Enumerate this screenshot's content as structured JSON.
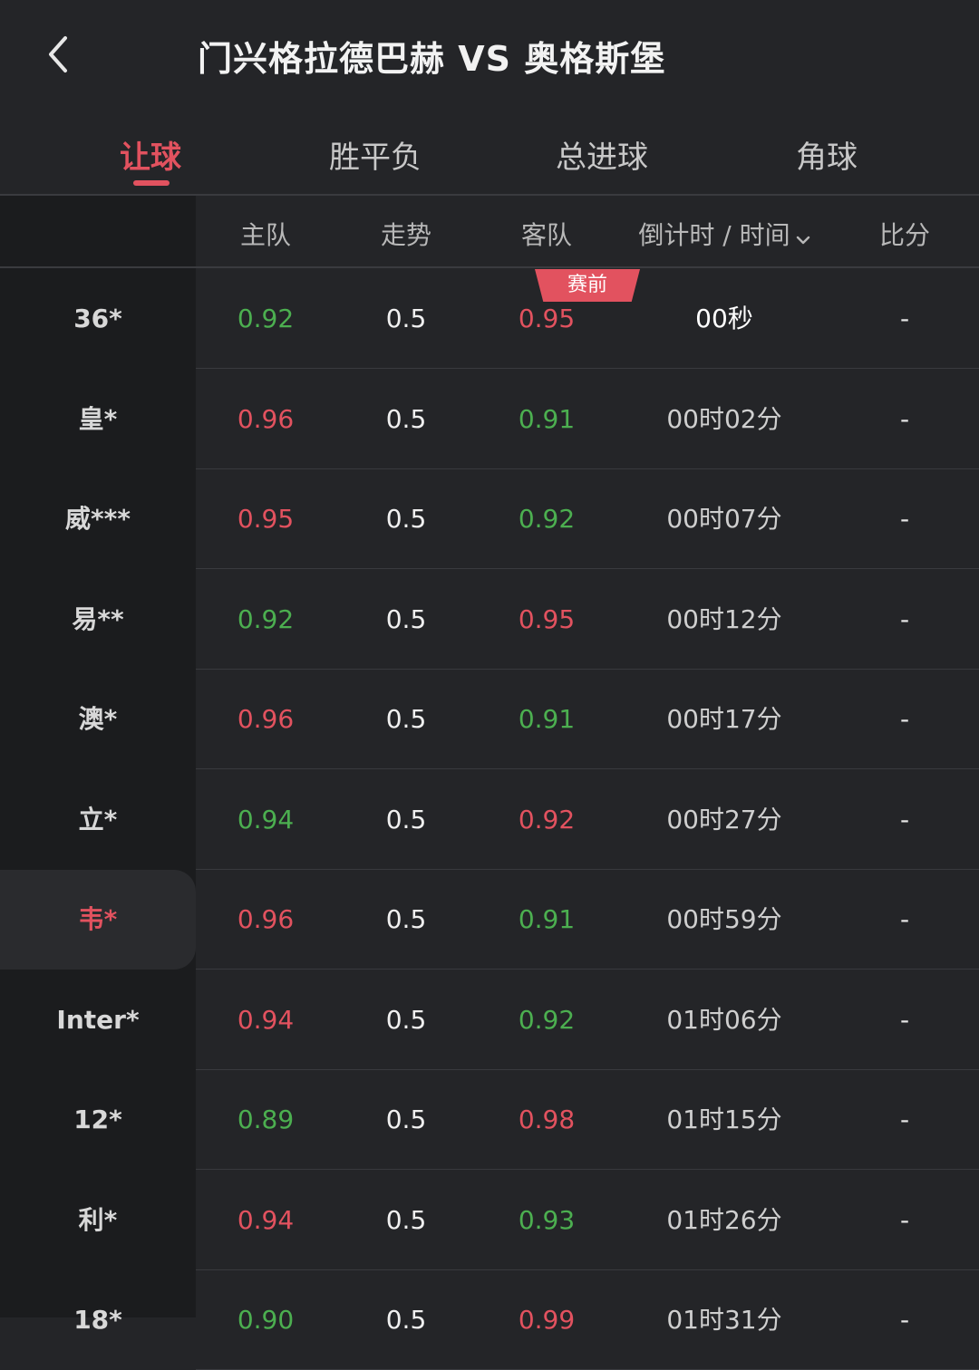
{
  "header": {
    "title": "门兴格拉德巴赫 VS 奥格斯堡"
  },
  "tabs": [
    {
      "label": "让球",
      "active": true
    },
    {
      "label": "胜平负",
      "active": false
    },
    {
      "label": "总进球",
      "active": false
    },
    {
      "label": "角球",
      "active": false
    }
  ],
  "columns": {
    "home": "主队",
    "trend": "走势",
    "away": "客队",
    "time": "倒计时 / 时间",
    "score": "比分"
  },
  "badge": "赛前",
  "rows": [
    {
      "name": "36*",
      "home": "0.92",
      "home_color": "green",
      "trend": "0.5",
      "away": "0.95",
      "away_color": "red",
      "time": "00秒",
      "score": "-"
    },
    {
      "name": "皇*",
      "home": "0.96",
      "home_color": "red",
      "trend": "0.5",
      "away": "0.91",
      "away_color": "green",
      "time": "00时02分",
      "score": "-"
    },
    {
      "name": "威***",
      "home": "0.95",
      "home_color": "red",
      "trend": "0.5",
      "away": "0.92",
      "away_color": "green",
      "time": "00时07分",
      "score": "-"
    },
    {
      "name": "易**",
      "home": "0.92",
      "home_color": "green",
      "trend": "0.5",
      "away": "0.95",
      "away_color": "red",
      "time": "00时12分",
      "score": "-"
    },
    {
      "name": "澳*",
      "home": "0.96",
      "home_color": "red",
      "trend": "0.5",
      "away": "0.91",
      "away_color": "green",
      "time": "00时17分",
      "score": "-"
    },
    {
      "name": "立*",
      "home": "0.94",
      "home_color": "green",
      "trend": "0.5",
      "away": "0.92",
      "away_color": "red",
      "time": "00时27分",
      "score": "-"
    },
    {
      "name": "韦*",
      "home": "0.96",
      "home_color": "red",
      "trend": "0.5",
      "away": "0.91",
      "away_color": "green",
      "time": "00时59分",
      "score": "-"
    },
    {
      "name": "Inter*",
      "home": "0.94",
      "home_color": "red",
      "trend": "0.5",
      "away": "0.92",
      "away_color": "green",
      "time": "01时06分",
      "score": "-"
    },
    {
      "name": "12*",
      "home": "0.89",
      "home_color": "green",
      "trend": "0.5",
      "away": "0.98",
      "away_color": "red",
      "time": "01时15分",
      "score": "-"
    },
    {
      "name": "利*",
      "home": "0.94",
      "home_color": "red",
      "trend": "0.5",
      "away": "0.93",
      "away_color": "green",
      "time": "01时26分",
      "score": "-"
    },
    {
      "name": "18*",
      "home": "0.90",
      "home_color": "green",
      "trend": "0.5",
      "away": "0.99",
      "away_color": "red",
      "time": "01时31分",
      "score": "-"
    }
  ],
  "colors": {
    "accent": "#e2525f",
    "up_green": "#4caf50",
    "bg": "#242528",
    "sidebar": "#1b1c1e"
  }
}
